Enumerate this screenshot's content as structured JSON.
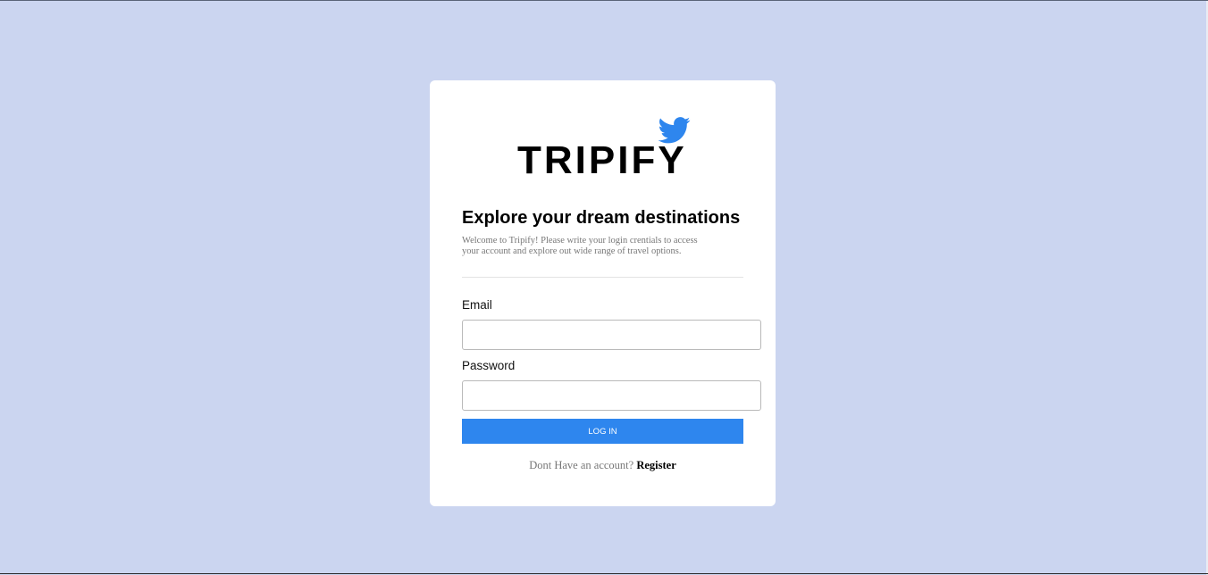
{
  "brand": {
    "name": "TRIPIFY",
    "icon": "twitter-bird-icon",
    "icon_color": "#2e86ee"
  },
  "login": {
    "headline": "Explore your dream destinations",
    "intro_line1": "Welcome to Tripify! Please write your login crentials to access",
    "intro_line2": "your account and explore out wide range of travel options.",
    "email_label": "Email",
    "email_value": "",
    "password_label": "Password",
    "password_value": "",
    "submit_label": "LOG IN",
    "register_prompt": "Dont Have an account?",
    "register_link": "Register"
  },
  "colors": {
    "background": "#cbd5f0",
    "card": "#ffffff",
    "button": "#2e86ee"
  }
}
